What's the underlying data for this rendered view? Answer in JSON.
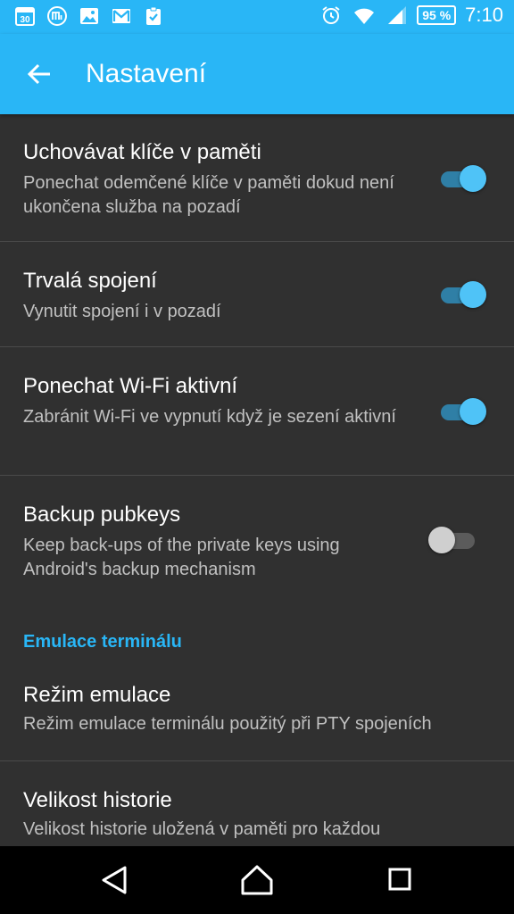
{
  "status_bar": {
    "notification_icons": [
      "calendar-icon",
      "mi-icon",
      "image-icon",
      "gmail-icon",
      "clipboard-check-icon"
    ],
    "calendar_day": "30",
    "battery": "95 %",
    "time": "7:10"
  },
  "app_bar": {
    "title": "Nastavení"
  },
  "preferences": [
    {
      "title": "Uchovávat klíče v paměti",
      "summary": "Ponechat odemčené klíče v paměti dokud není ukončena služba na pozadí",
      "enabled": true
    },
    {
      "title": "Trvalá spojení",
      "summary": "Vynutit spojení i v pozadí",
      "enabled": true
    },
    {
      "title": "Ponechat Wi-Fi aktivní",
      "summary": "Zabránit Wi-Fi ve vypnutí když je sezení aktivní",
      "enabled": true
    },
    {
      "title": "Backup pubkeys",
      "summary": "Keep back-ups of the private keys using Android's backup mechanism",
      "enabled": false
    }
  ],
  "category": {
    "label": "Emulace terminálu"
  },
  "emulation_prefs": [
    {
      "title": "Režim emulace",
      "summary": "Režim emulace terminálu použitý při PTY spojeních"
    },
    {
      "title": "Velikost historie",
      "summary": "Velikost historie uložená v paměti pro každou"
    }
  ],
  "colors": {
    "accent": "#29b6f6",
    "background": "#303030"
  }
}
